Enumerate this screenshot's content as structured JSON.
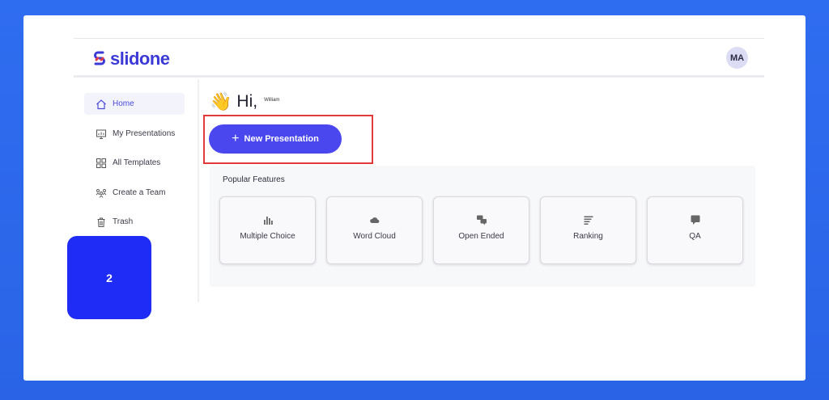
{
  "app": {
    "logo_text": "slidone"
  },
  "user": {
    "initials": "MA",
    "greeting": "Hi,",
    "name": "William"
  },
  "sidebar": {
    "items": [
      {
        "label": "Home",
        "icon": "home-icon",
        "active": true
      },
      {
        "label": "My Presentations",
        "icon": "presentation-icon",
        "active": false
      },
      {
        "label": "All Templates",
        "icon": "grid-icon",
        "active": false
      },
      {
        "label": "Create a Team",
        "icon": "team-icon",
        "active": false
      },
      {
        "label": "Trash",
        "icon": "trash-icon",
        "active": false
      }
    ]
  },
  "main": {
    "new_button_label": "New Presentation",
    "features_title": "Popular Features",
    "features": [
      {
        "label": "Multiple Choice",
        "icon": "bar-chart-icon"
      },
      {
        "label": "Word Cloud",
        "icon": "cloud-icon"
      },
      {
        "label": "Open Ended",
        "icon": "chat-bubbles-icon"
      },
      {
        "label": "Ranking",
        "icon": "ranking-lines-icon"
      },
      {
        "label": "QA",
        "icon": "speech-bubble-icon"
      }
    ]
  },
  "overlay": {
    "step_number": "2"
  },
  "colors": {
    "accent": "#4b47ee",
    "brand": "#3b3ad6",
    "highlight": "#e03a3a",
    "badge": "#1f2cf5",
    "background": "#2f6df0"
  }
}
